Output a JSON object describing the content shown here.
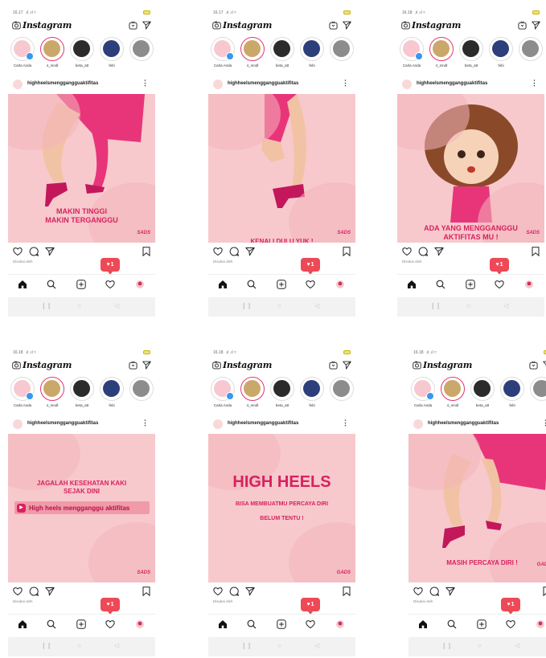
{
  "app": {
    "logo": "Instagram",
    "status_time": [
      "16.17",
      "16.17",
      "16.18",
      "16.18",
      "16.18",
      "16.18"
    ],
    "account": "highheelsmenggangguaktifitas",
    "likes_text": "Disukai oleh",
    "notification_count": "1",
    "stories": [
      "Carla Anda",
      "4_mndl",
      "beta_att",
      "febi",
      ""
    ]
  },
  "posts": [
    {
      "lines": [
        "MAKIN TINGGI",
        "MAKIN TERGANGGU"
      ],
      "sig": "SADS"
    },
    {
      "lines": [
        "KENALI DULU YUK !"
      ],
      "sig": "SADS"
    },
    {
      "lines": [
        "ADA YANG MENGGANGGU",
        "AKTIFITAS MU !"
      ],
      "sig": "SADS"
    },
    {
      "lines": [
        "JAGALAH KESEHATAN KAKI",
        "SEJAK DINI"
      ],
      "tag": "High heels mengganggu aktifitas",
      "sig": "SADS"
    },
    {
      "title": "HIGH HEELS",
      "lines": [
        "BISA MEMBUATMU PERCAYA DIRI",
        "BELUM TENTU !"
      ],
      "sig": "GADS"
    },
    {
      "lines": [
        "MASIH PERCAYA DIRI !"
      ],
      "sig": "GADS"
    }
  ],
  "colors": {
    "post_bg": "#f7c9cd",
    "accent": "#d8215f",
    "badge": "#ed4956"
  }
}
